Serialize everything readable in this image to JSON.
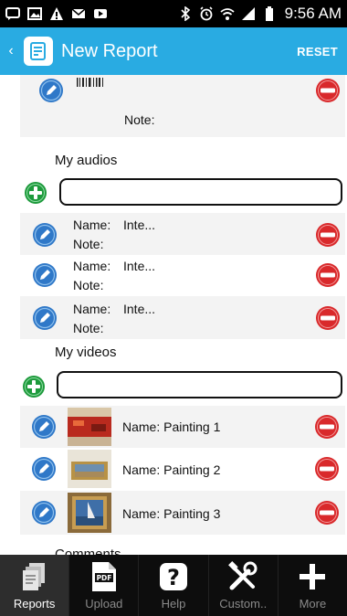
{
  "status_bar": {
    "time": "9:56 AM"
  },
  "header": {
    "title": "New Report",
    "reset_label": "RESET"
  },
  "top_item": {
    "note_label": "Note:"
  },
  "audios": {
    "title": "My audios",
    "items": [
      {
        "name_label": "Name:",
        "name_value": "Inte...",
        "note_label": "Note:"
      },
      {
        "name_label": "Name:",
        "name_value": "Inte...",
        "note_label": "Note:"
      },
      {
        "name_label": "Name:",
        "name_value": "Inte...",
        "note_label": "Note:"
      }
    ]
  },
  "videos": {
    "title": "My videos",
    "items": [
      {
        "label": "Name: Painting 1"
      },
      {
        "label": "Name: Painting 2"
      },
      {
        "label": "Name: Painting 3"
      }
    ]
  },
  "comments": {
    "title": "Comments"
  },
  "bottom_nav": {
    "tabs": [
      {
        "label": "Reports",
        "icon": "reports-icon",
        "active": true
      },
      {
        "label": "Upload",
        "icon": "pdf-upload-icon",
        "active": false
      },
      {
        "label": "Help",
        "icon": "help-icon",
        "active": false
      },
      {
        "label": "Custom..",
        "icon": "tools-icon",
        "active": false
      },
      {
        "label": "More",
        "icon": "plus-icon",
        "active": false
      }
    ]
  },
  "colors": {
    "accent": "#29abe2",
    "delete": "#d9292b",
    "add": "#1e9a3c",
    "edit": "#2f78c8"
  }
}
